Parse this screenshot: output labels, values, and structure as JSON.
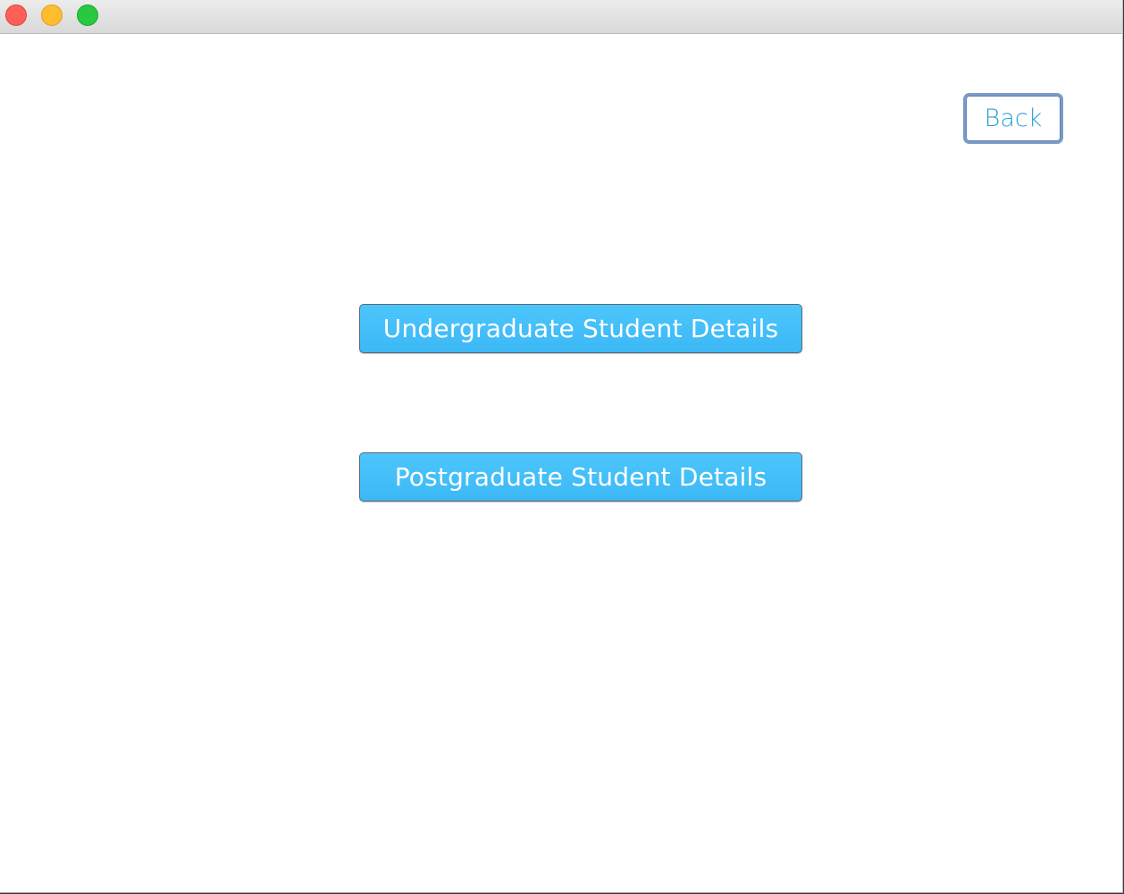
{
  "window": {
    "controls": [
      "close",
      "minimize",
      "zoom"
    ]
  },
  "toolbar": {
    "back_label": "Back"
  },
  "main": {
    "undergrad_label": "Undergraduate Student Details",
    "postgrad_label": "Postgraduate Student Details"
  },
  "colors": {
    "button_fill": "#44c0f9",
    "back_text": "#2ba3d6",
    "back_border": "#7a9cc6"
  }
}
